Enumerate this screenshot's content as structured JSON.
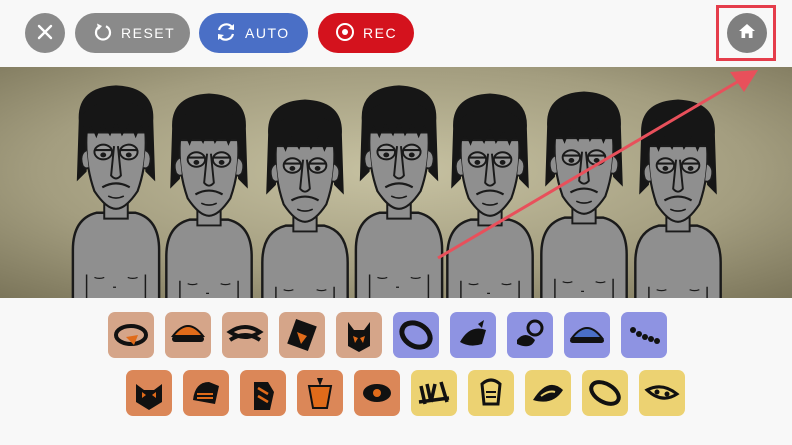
{
  "toolbar": {
    "close_icon": "close-icon",
    "reset_label": "RESET",
    "auto_label": "AUTO",
    "rec_label": "REC",
    "home_icon": "home-icon"
  },
  "stage": {
    "performer_count": 7,
    "background": "#9e9878"
  },
  "sound_icons": {
    "rows": [
      [
        {
          "name": "beat-1",
          "color": "#d5a589"
        },
        {
          "name": "beat-2",
          "color": "#d5a589"
        },
        {
          "name": "beat-3",
          "color": "#d5a589"
        },
        {
          "name": "beat-4",
          "color": "#d5a589"
        },
        {
          "name": "beat-5",
          "color": "#d5a589"
        },
        {
          "name": "effect-1",
          "color": "#8e93e2"
        },
        {
          "name": "effect-2",
          "color": "#8e93e2"
        },
        {
          "name": "effect-3",
          "color": "#8e93e2"
        },
        {
          "name": "effect-4",
          "color": "#8e93e2"
        },
        {
          "name": "effect-5",
          "color": "#8e93e2"
        }
      ],
      [
        {
          "name": "melody-1",
          "color": "#db8758"
        },
        {
          "name": "melody-2",
          "color": "#db8758"
        },
        {
          "name": "melody-3",
          "color": "#db8758"
        },
        {
          "name": "melody-4",
          "color": "#db8758"
        },
        {
          "name": "melody-5",
          "color": "#db8758"
        },
        {
          "name": "voice-1",
          "color": "#ecd272"
        },
        {
          "name": "voice-2",
          "color": "#ecd272"
        },
        {
          "name": "voice-3",
          "color": "#ecd272"
        },
        {
          "name": "voice-4",
          "color": "#ecd272"
        },
        {
          "name": "voice-5",
          "color": "#ecd272"
        }
      ]
    ]
  },
  "colors": {
    "reset": "#8a8a8a",
    "auto": "#4a6fc6",
    "rec": "#d4121d",
    "highlight": "#e53d4b"
  }
}
